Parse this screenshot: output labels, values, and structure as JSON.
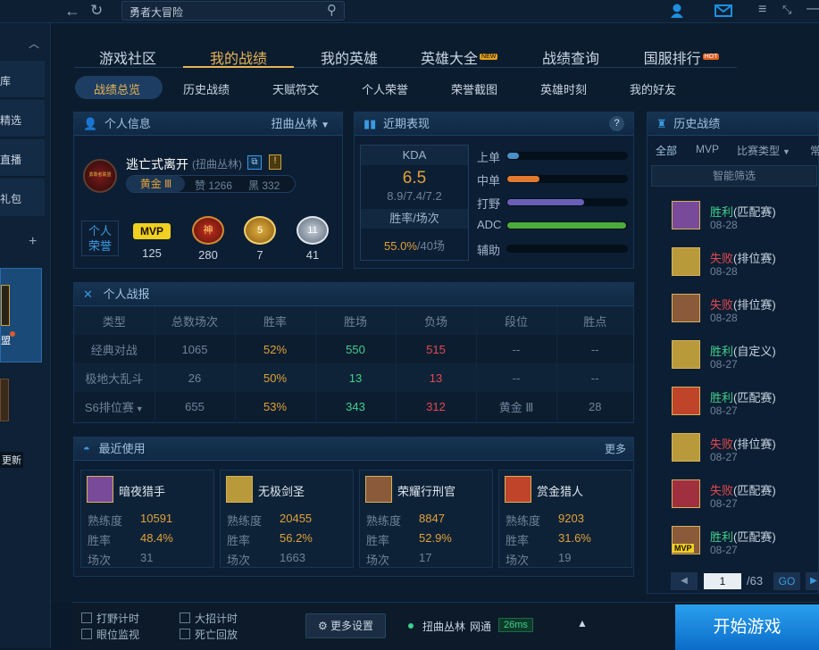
{
  "topbar": {
    "search_text": "勇者大冒险"
  },
  "sidebar": {
    "items": [
      "库",
      "精选",
      "直播",
      "礼包"
    ],
    "tag_label": "盟",
    "update_label": "更新"
  },
  "nav": {
    "tabs": [
      "游戏社区",
      "我的战绩",
      "我的英雄",
      "英雄大全",
      "战绩查询",
      "国服排行"
    ],
    "new_badge": "NEW",
    "hot_badge": "HOT",
    "active": "我的战绩"
  },
  "subnav": {
    "tabs": [
      "战绩总览",
      "历史战绩",
      "天赋符文",
      "个人荣誉",
      "荣誉截图",
      "英雄时刻",
      "我的好友"
    ],
    "active": "战绩总览"
  },
  "info": {
    "title": "个人信息",
    "server": "扭曲丛林",
    "name": "逃亡式离开",
    "server_paren": "(扭曲丛林)",
    "rank": "黄金 Ⅲ",
    "likes": "赞 1266",
    "blacks": "黑 332",
    "honor_label_1": "个人",
    "honor_label_2": "荣誉",
    "honors": [
      {
        "label": "MVP",
        "count": "125"
      },
      {
        "label": "神",
        "count": "280"
      },
      {
        "label": "5",
        "count": "7"
      },
      {
        "label": "11",
        "count": "41"
      }
    ],
    "avatar_text": "勇敢者联盟"
  },
  "recent_perf": {
    "title": "近期表现",
    "kda_label": "KDA",
    "kda": "6.5",
    "kda_detail": "8.9/7.4/7.2",
    "rate_label": "胜率/场次",
    "rate": "55.0%",
    "games": "/40场",
    "help": "?",
    "roles": [
      {
        "name": "上单",
        "value": 0.1,
        "color": "#4a8fc7"
      },
      {
        "name": "中单",
        "value": 0.27,
        "color": "#e07a30"
      },
      {
        "name": "打野",
        "value": 0.64,
        "color": "#6a5fb8"
      },
      {
        "name": "ADC",
        "value": 0.99,
        "color": "#4cab3a"
      },
      {
        "name": "辅助",
        "value": 0.0,
        "color": "#4a8fc7"
      }
    ]
  },
  "report": {
    "title": "个人战报",
    "headers": [
      "类型",
      "总数场次",
      "胜率",
      "胜场",
      "负场",
      "段位",
      "胜点"
    ],
    "rows": [
      [
        "经典对战",
        "1065",
        "52%",
        "550",
        "515",
        "--",
        "--"
      ],
      [
        "极地大乱斗",
        "26",
        "50%",
        "13",
        "13",
        "--",
        "--"
      ],
      [
        "S6排位赛",
        "655",
        "53%",
        "343",
        "312",
        "黄金 Ⅲ",
        "28"
      ]
    ]
  },
  "recent_used": {
    "title": "最近使用",
    "more": "更多",
    "labels": [
      "熟练度",
      "胜率",
      "场次"
    ],
    "champs": [
      {
        "name": "暗夜猎手",
        "mastery": "10591",
        "rate": "48.4%",
        "games": "31",
        "color": "#7a4a9a"
      },
      {
        "name": "无极剑圣",
        "mastery": "20455",
        "rate": "56.2%",
        "games": "1663",
        "color": "#b89a3a"
      },
      {
        "name": "荣耀行刑官",
        "mastery": "8847",
        "rate": "52.9%",
        "games": "17",
        "color": "#8a5a3a"
      },
      {
        "name": "赏金猎人",
        "mastery": "9203",
        "rate": "31.6%",
        "games": "19",
        "color": "#c0442a"
      }
    ]
  },
  "history": {
    "title": "历史战绩",
    "filters": [
      "全部",
      "MVP",
      "比赛类型",
      "常"
    ],
    "smart": "智能筛选",
    "items": [
      {
        "result": "胜利",
        "mode": "(匹配赛)",
        "date": "08-28",
        "win": true,
        "color": "#7a4a9a"
      },
      {
        "result": "失败",
        "mode": "(排位赛)",
        "date": "08-28",
        "win": false,
        "color": "#b89a3a"
      },
      {
        "result": "失败",
        "mode": "(排位赛)",
        "date": "08-28",
        "win": false,
        "color": "#8a5a3a"
      },
      {
        "result": "胜利",
        "mode": "(自定义)",
        "date": "08-27",
        "win": true,
        "color": "#b89a3a"
      },
      {
        "result": "胜利",
        "mode": "(匹配赛)",
        "date": "08-27",
        "win": true,
        "color": "#c0442a"
      },
      {
        "result": "失败",
        "mode": "(排位赛)",
        "date": "08-27",
        "win": false,
        "color": "#b89a3a"
      },
      {
        "result": "失败",
        "mode": "(匹配赛)",
        "date": "08-27",
        "win": false,
        "color": "#a03040"
      },
      {
        "result": "胜利",
        "mode": "(匹配赛)",
        "date": "08-27",
        "win": true,
        "color": "#8a5a3a",
        "mvp": "MVP"
      }
    ],
    "page": "1",
    "total": "/63",
    "go": "GO"
  },
  "footer": {
    "jungle_timer": "打野计时",
    "ult_timer": "大招计时",
    "ward_monitor": "眼位监视",
    "death_replay": "死亡回放",
    "more_settings": "更多设置",
    "server": "扭曲丛林",
    "network": "网通",
    "ping": "26ms",
    "start": "开始游戏"
  }
}
